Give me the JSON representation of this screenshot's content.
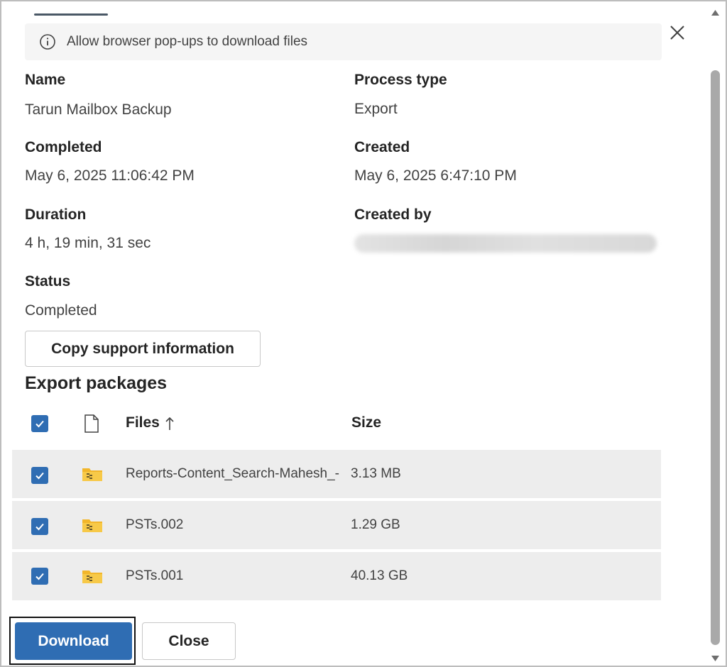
{
  "info_bar": {
    "text": "Allow browser pop-ups to download files",
    "icon": "info-icon"
  },
  "details": {
    "name_label": "Name",
    "name_value": "Tarun Mailbox Backup",
    "process_type_label": "Process type",
    "process_type_value": "Export",
    "completed_label": "Completed",
    "completed_value": "May 6, 2025 11:06:42 PM",
    "created_label": "Created",
    "created_value": "May 6, 2025 6:47:10 PM",
    "duration_label": "Duration",
    "duration_value": "4 h, 19 min, 31 sec",
    "created_by_label": "Created by",
    "status_label": "Status",
    "status_value": "Completed"
  },
  "copy_button_label": "Copy support information",
  "packages": {
    "title": "Export packages",
    "columns": {
      "files": "Files",
      "size": "Size"
    },
    "sort": "ascending",
    "rows": [
      {
        "name": "Reports-Content_Search-Mahesh_-",
        "size": "3.13 MB",
        "checked": true
      },
      {
        "name": "PSTs.002",
        "size": "1.29 GB",
        "checked": true
      },
      {
        "name": "PSTs.001",
        "size": "40.13 GB",
        "checked": true
      }
    ]
  },
  "footer": {
    "download_label": "Download",
    "close_label": "Close"
  },
  "colors": {
    "accent": "#2f6db3",
    "row_bg": "#ededed",
    "zip_icon": "#e8b020"
  }
}
